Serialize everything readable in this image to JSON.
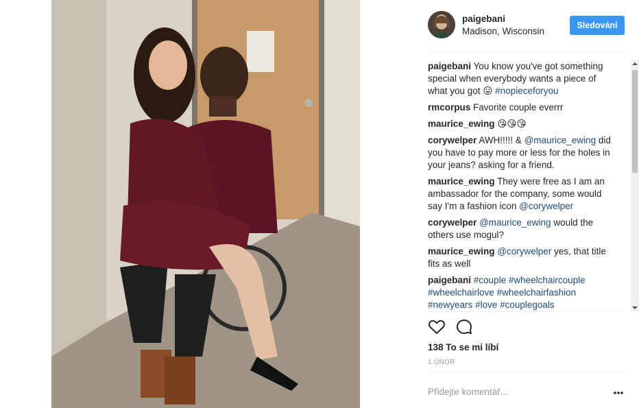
{
  "post": {
    "username": "paigebani",
    "location": "Madison, Wisconsin",
    "follow_label": "Sledování",
    "likes_text": "138 To se mi líbí",
    "date_text": "1 ÚNOR",
    "comment_placeholder": "Přidejte komentář..."
  },
  "comments": [
    {
      "user": "paigebani",
      "parts": [
        {
          "t": "text",
          "v": "You know you've got something special when everybody wants a piece of what you got "
        },
        {
          "t": "emoji",
          "v": "😛"
        },
        {
          "t": "text",
          "v": " "
        },
        {
          "t": "tag",
          "v": "#nopieceforyou"
        }
      ]
    },
    {
      "user": "rmcorpus",
      "parts": [
        {
          "t": "text",
          "v": "Favorite couple everrr"
        }
      ]
    },
    {
      "user": "maurice_ewing",
      "parts": [
        {
          "t": "emoji",
          "v": "😘😘😘"
        }
      ]
    },
    {
      "user": "corywelper",
      "parts": [
        {
          "t": "text",
          "v": "AWH!!!!! & "
        },
        {
          "t": "mention",
          "v": "@maurice_ewing"
        },
        {
          "t": "text",
          "v": " did you have to pay more or less for the holes in your jeans? asking for a friend."
        }
      ]
    },
    {
      "user": "maurice_ewing",
      "parts": [
        {
          "t": "text",
          "v": "They were free as I am an ambassador for the company, some would say I'm a fashion icon "
        },
        {
          "t": "mention",
          "v": "@corywelper"
        }
      ]
    },
    {
      "user": "corywelper",
      "parts": [
        {
          "t": "mention",
          "v": "@maurice_ewing"
        },
        {
          "t": "text",
          "v": " would the others use mogul?"
        }
      ]
    },
    {
      "user": "maurice_ewing",
      "parts": [
        {
          "t": "mention",
          "v": "@corywelper"
        },
        {
          "t": "text",
          "v": " yes, that title fits as well"
        }
      ]
    },
    {
      "user": "paigebani",
      "parts": [
        {
          "t": "tag",
          "v": "#couple"
        },
        {
          "t": "text",
          "v": " "
        },
        {
          "t": "tag",
          "v": "#wheelchaircouple"
        },
        {
          "t": "text",
          "v": " "
        },
        {
          "t": "tag",
          "v": "#wheelchairlove"
        },
        {
          "t": "text",
          "v": " "
        },
        {
          "t": "tag",
          "v": "#wheelchairfashion"
        },
        {
          "t": "text",
          "v": " "
        },
        {
          "t": "tag",
          "v": "#newyears"
        },
        {
          "t": "text",
          "v": " "
        },
        {
          "t": "tag",
          "v": "#love"
        },
        {
          "t": "text",
          "v": " "
        },
        {
          "t": "tag",
          "v": "#couplegoals"
        }
      ]
    }
  ],
  "icons": {
    "like": "heart-icon",
    "comment": "comment-bubble-icon",
    "more": "more-dots-icon"
  },
  "colors": {
    "follow_button": "#3897f0",
    "link": "#1f4b7a"
  }
}
